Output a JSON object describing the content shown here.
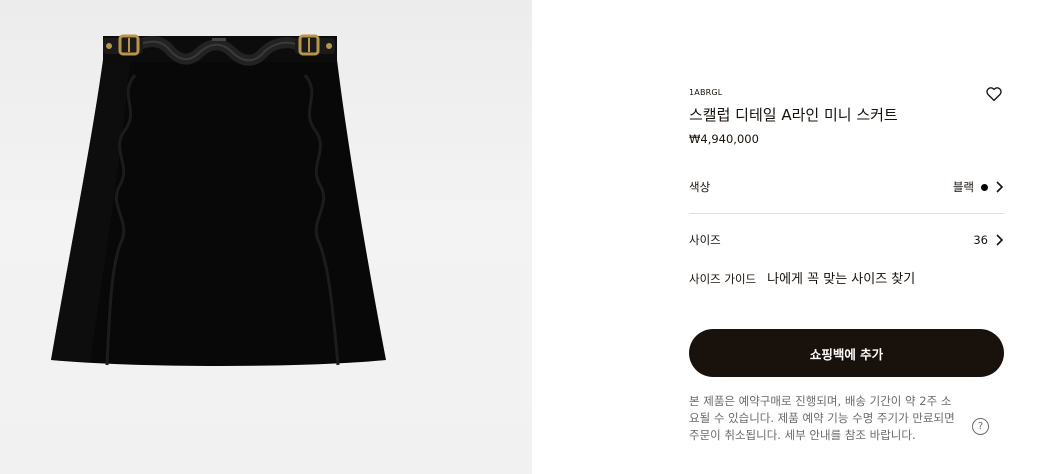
{
  "product": {
    "sku": "1ABRGL",
    "title": "스캘럽 디테일 A라인 미니 스커트",
    "price": "₩4,940,000",
    "image_alt": "black mini skirt with belt"
  },
  "options": {
    "color_label": "색상",
    "color_value": "블랙",
    "color_swatch": "#000000",
    "size_label": "사이즈",
    "size_value": "36"
  },
  "size_guide": {
    "label": "사이즈 가이드",
    "find_label": "나에게 꼭 맞는 사이즈 찾기"
  },
  "cta": {
    "add_to_bag": "쇼핑백에 추가"
  },
  "notice": {
    "text": "본 제품은 예약구매로 진행되며, 배송 기간이 약 2주 소요될 수 있습니다. 제품 예약 기능 수명 주기가 만료되면 주문이 취소됩니다. 세부 안내를 참조 바랍니다.",
    "help_symbol": "?"
  },
  "icons": {
    "wishlist": "heart-icon",
    "chevron": "chevron-right-icon",
    "help": "question-circle-icon"
  },
  "colors": {
    "brand_dark": "#19110b",
    "divider": "#e1dfdd",
    "muted_text": "#6b6b6b"
  }
}
